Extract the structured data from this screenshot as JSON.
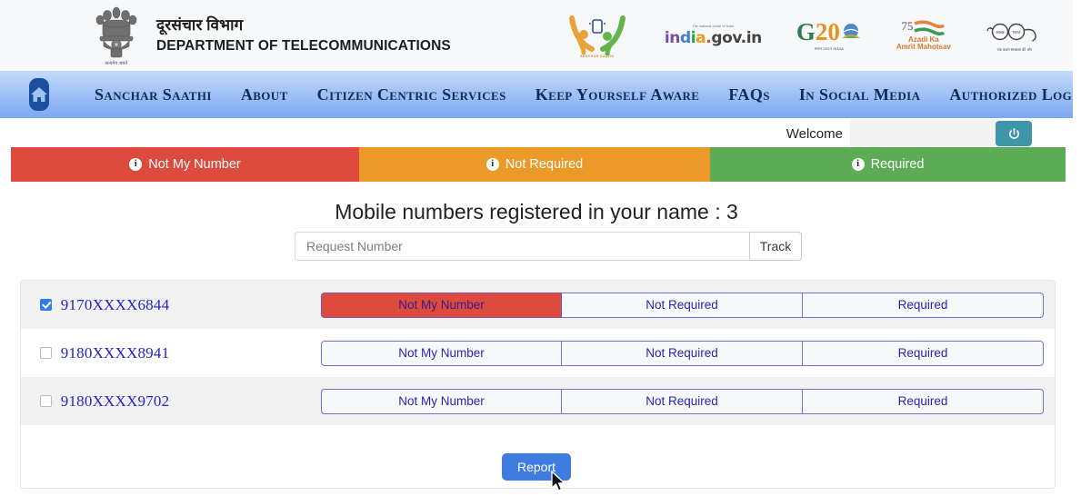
{
  "header": {
    "emblem_alt": "national-emblem-of-india",
    "dept_hindi": "दूरसंचार विभाग",
    "dept_english": "DEPARTMENT OF TELECOMMUNICATIONS",
    "logos": [
      {
        "name": "sanchar-saathi-logo",
        "caption": "SANCHAR SAATHI"
      },
      {
        "name": "india-gov-in-logo",
        "tagline": "The national portal of India",
        "text": "india.gov.in"
      },
      {
        "name": "g20-logo",
        "g": "G",
        "two_zero": "20",
        "caption": "भारत 2023 INDIA"
      },
      {
        "name": "azadi-ka-amrit-mahotsav-logo",
        "num": "75",
        "line1": "Azadi Ka",
        "line2": "Amrit Mahotsav"
      },
      {
        "name": "swachh-bharat-logo",
        "caption": "एक कदम स्वच्छता की ओर"
      }
    ]
  },
  "nav": {
    "home_icon": "home-icon",
    "items": [
      {
        "label": "Sanchar Saathi",
        "key": "sanchar-saathi"
      },
      {
        "label": "About",
        "key": "about"
      },
      {
        "label": "Citizen Centric Services",
        "key": "citizen-centric-services"
      },
      {
        "label": "Keep Yourself Aware",
        "key": "keep-yourself-aware"
      },
      {
        "label": "FAQs",
        "key": "faqs"
      },
      {
        "label": "In Social Media",
        "key": "in-social-media"
      },
      {
        "label": "Authorized Login",
        "key": "authorized-login"
      }
    ]
  },
  "welcome": {
    "label": "Welcome",
    "logout_icon": "power-icon",
    "logout_color": "#3e97a8"
  },
  "legend": [
    {
      "label": "Not My Number",
      "color": "#dd4b3e",
      "icon": "info-icon",
      "glyph": "i"
    },
    {
      "label": "Not Required",
      "color": "#eb9a29",
      "icon": "info-icon",
      "glyph": "i"
    },
    {
      "label": "Required",
      "color": "#5cab55",
      "icon": "info-icon",
      "glyph": "i"
    }
  ],
  "main": {
    "title": "Mobile numbers registered in your name : 3",
    "registered_count": 3
  },
  "track": {
    "placeholder": "Request Number",
    "value": "",
    "button_label": "Track"
  },
  "table": {
    "options": [
      "Not My Number",
      "Not Required",
      "Required"
    ],
    "rows": [
      {
        "number": "9170XXXX6844",
        "checked": true,
        "selected_option": "Not My Number"
      },
      {
        "number": "9180XXXX8941",
        "checked": false,
        "selected_option": ""
      },
      {
        "number": "9180XXXX9702",
        "checked": false,
        "selected_option": ""
      }
    ]
  },
  "footer": {
    "report_label": "Report",
    "report_color": "#3f7ce0"
  }
}
